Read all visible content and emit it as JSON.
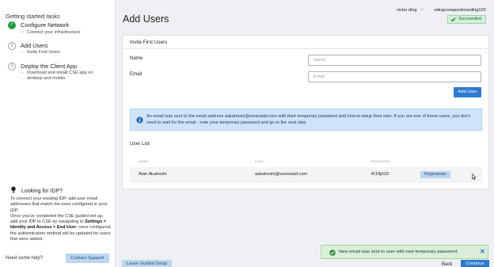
{
  "sidebar": {
    "title": "Getting started tasks",
    "steps": [
      {
        "badge": "✓",
        "title": "Configure Network",
        "sub": "Connect your infrastructure",
        "state": "done"
      },
      {
        "badge": "2",
        "title": "Add Users",
        "sub": "Invite First Users",
        "state": "todo"
      },
      {
        "badge": "3",
        "title": "Deploy the Client App",
        "sub": "Download and install CSE app on desktop and mobile",
        "state": "todo"
      }
    ],
    "idp": {
      "title": "Looking for IDP?",
      "body_1": "To connect your existing IDP, add user email addresses that match the ones configured in your IDP.",
      "body_2": "Once you've completed the CSE guided set up, add your IDP to CSE by navigating to ",
      "body_bold": "Settings > Identity and Access > End User",
      "body_3": "; once configured, the authentication method will be updated for users that were added."
    },
    "need_help": "Need some help?",
    "contact_support": "Contact Support"
  },
  "header": {
    "user_name": "victor ding",
    "org_name": "vdingcseqaonboarding103",
    "status": "Succeeded"
  },
  "main": {
    "page_title": "Add Users",
    "card_title": "Invite First Users",
    "name_label": "Name",
    "name_placeholder": "Name",
    "email_label": "Email",
    "email_placeholder": "Email",
    "add_user": "Add User",
    "info": "An email was sent to the email address aakahoshi@sonicwall.com with their temporary password and how to setup their own. If you are one of these users, you don't need to wait for the email - note your temporary password and go to the next step",
    "user_list_title": "User List",
    "columns": [
      "NAME",
      "EMAIL",
      "PASSWORD"
    ],
    "users": [
      {
        "name": "Alan Akahoshi",
        "email": "aakahoshi@sonicwall.com",
        "password": "lK1flpGD",
        "action": "Regenerate"
      }
    ]
  },
  "footer": {
    "leave": "Leave Guided Setup",
    "back": "Back",
    "continue": "Continue"
  },
  "toast": {
    "message": "New email was sent to user with new temporary password.",
    "close": "✕"
  },
  "colors": {
    "primary": "#2b7ad0",
    "success": "#1f9d3a",
    "info_bg": "#cfe4f8",
    "toast_bg": "#dbefd8"
  }
}
